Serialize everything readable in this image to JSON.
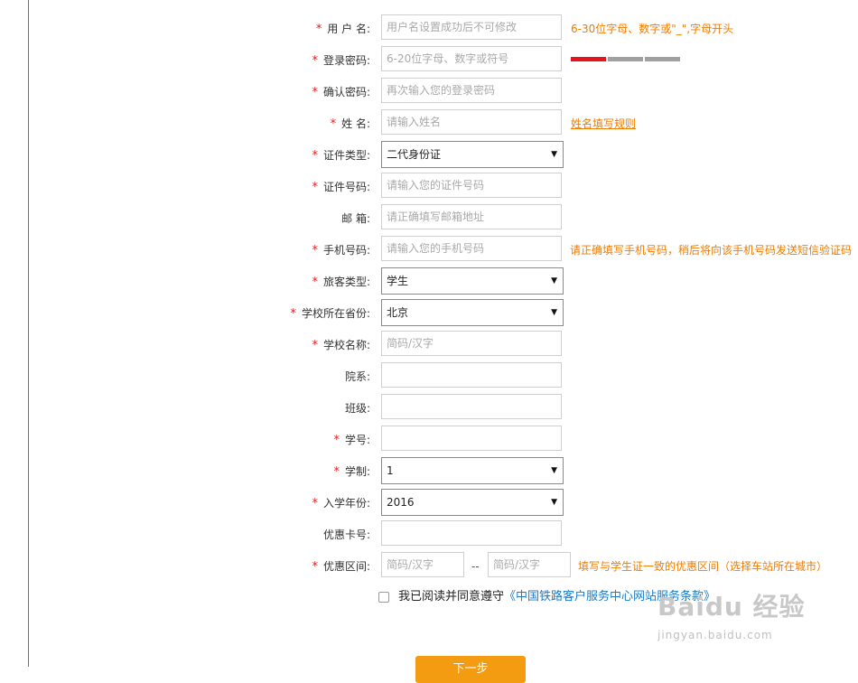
{
  "form": {
    "username": {
      "label": "用 户 名:",
      "required": true,
      "placeholder": "用户名设置成功后不可修改",
      "hint": "6-30位字母、数字或\"_\",字母开头"
    },
    "password": {
      "label": "登录密码:",
      "required": true,
      "placeholder": "6-20位字母、数字或符号",
      "strength_level": 1,
      "strength_total": 3,
      "strength_colors": [
        "#e6141e",
        "#a0a0a0",
        "#a0a0a0"
      ]
    },
    "confirm_password": {
      "label": "确认密码:",
      "required": true,
      "placeholder": "再次输入您的登录密码"
    },
    "name": {
      "label": "姓 名:",
      "required": true,
      "placeholder": "请输入姓名",
      "hint_link": "姓名填写规则"
    },
    "id_type": {
      "label": "证件类型:",
      "required": true,
      "value": "二代身份证"
    },
    "id_number": {
      "label": "证件号码:",
      "required": true,
      "placeholder": "请输入您的证件号码"
    },
    "email": {
      "label": "邮 箱:",
      "required": false,
      "placeholder": "请正确填写邮箱地址"
    },
    "phone": {
      "label": "手机号码:",
      "required": true,
      "placeholder": "请输入您的手机号码",
      "hint": "请正确填写手机号码，稍后将向该手机号码发送短信验证码"
    },
    "passenger_type": {
      "label": "旅客类型:",
      "required": true,
      "value": "学生"
    },
    "school_province": {
      "label": "学校所在省份:",
      "required": true,
      "value": "北京"
    },
    "school_name": {
      "label": "学校名称:",
      "required": true,
      "placeholder": "简码/汉字"
    },
    "department": {
      "label": "院系:",
      "required": false,
      "placeholder": ""
    },
    "class": {
      "label": "班级:",
      "required": false,
      "placeholder": ""
    },
    "student_id": {
      "label": "学号:",
      "required": true,
      "placeholder": ""
    },
    "duration": {
      "label": "学制:",
      "required": true,
      "value": "1"
    },
    "enroll_year": {
      "label": "入学年份:",
      "required": true,
      "value": "2016"
    },
    "discount_card": {
      "label": "优惠卡号:",
      "required": false,
      "placeholder": ""
    },
    "discount_range": {
      "label": "优惠区间:",
      "required": true,
      "from_placeholder": "简码/汉字",
      "separator": "--",
      "to_placeholder": "简码/汉字",
      "hint": "填写与学生证一致的优惠区间（选择车站所在城市）"
    }
  },
  "required_mark": "*",
  "select_arrow": "▼",
  "agreement": {
    "checked": false,
    "text": "我已阅读并同意遵守",
    "link": "《中国铁路客户服务中心网站服务条款》"
  },
  "submit_label": "下一步",
  "watermark": {
    "main": "Baidu 经验",
    "sub": "jingyan.baidu.com"
  },
  "colors": {
    "accent": "#f07c00",
    "required": "#e02020",
    "link": "#1a7bc8",
    "border_left": "#1e88c8",
    "button": "#f39c12"
  }
}
